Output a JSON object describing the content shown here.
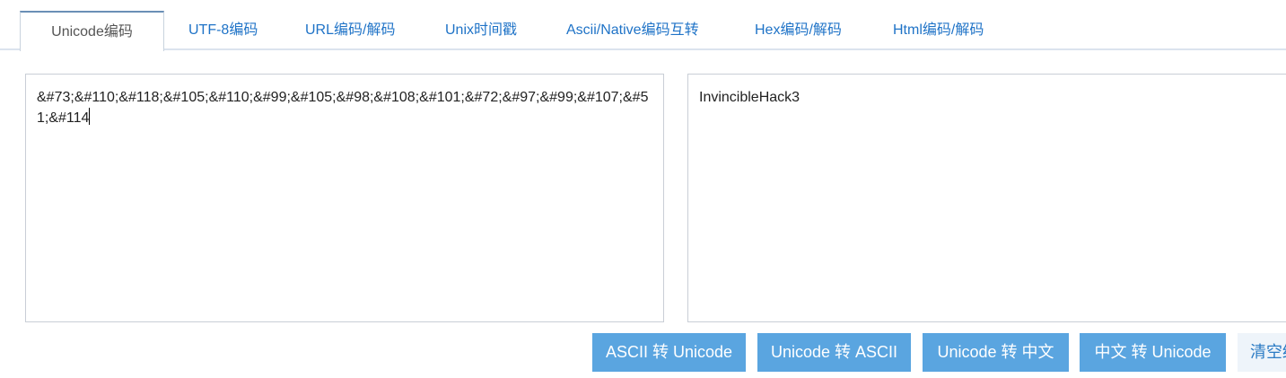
{
  "tabs": [
    {
      "label": "Unicode编码",
      "active": true
    },
    {
      "label": "UTF-8编码"
    },
    {
      "label": "URL编码/解码"
    },
    {
      "label": "Unix时间戳"
    },
    {
      "label": "Ascii/Native编码互转"
    },
    {
      "label": "Hex编码/解码"
    },
    {
      "label": "Html编码/解码"
    }
  ],
  "input": {
    "value": "&#73;&#110;&#118;&#105;&#110;&#99;&#105;&#98;&#108;&#101;&#72;&#97;&#99;&#107;&#51;&#114"
  },
  "output": {
    "value": "InvincibleHack3"
  },
  "buttons": {
    "ascii_to_unicode": "ASCII 转 Unicode",
    "unicode_to_ascii": "Unicode 转 ASCII",
    "unicode_to_chinese": "Unicode 转 中文",
    "chinese_to_unicode": "中文 转 Unicode",
    "clear": "清空结果"
  },
  "colors": {
    "tab_link": "#1f73c7",
    "button_bg": "#5aa5e0",
    "button_text": "#ffffff"
  }
}
